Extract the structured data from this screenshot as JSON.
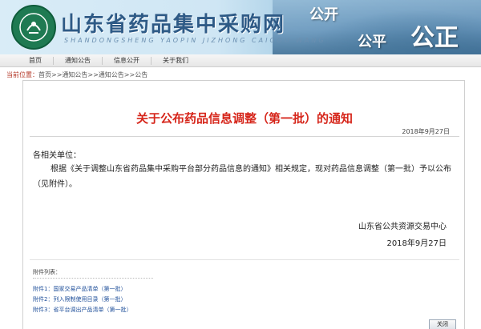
{
  "header": {
    "site_title": "山东省药品集中采购网",
    "site_subtitle": "SHANDONGSHENG YAOPIN JIZHONG CAIGOU WANG",
    "slogans": [
      "公开",
      "公平",
      "公正"
    ]
  },
  "nav": {
    "items": [
      {
        "label": "首页"
      },
      {
        "label": "通知公告"
      },
      {
        "label": "信息公开"
      },
      {
        "label": "关于我们"
      }
    ]
  },
  "breadcrumb": {
    "label": "当前位置：",
    "path": "首页>>通知公告>>通知公告>>公告"
  },
  "notice": {
    "title": "关于公布药品信息调整（第一批）的通知",
    "date": "2018年9月27日",
    "salutation": "各相关单位：",
    "body": "根据《关于调整山东省药品集中采购平台部分药品信息的通知》相关规定，现对药品信息调整（第一批）予以公布（见附件）。",
    "issuer": "山东省公共资源交易中心",
    "issue_date": "2018年9月27日"
  },
  "attachments": {
    "heading": "附件列表：",
    "items": [
      {
        "prefix": "附件1：",
        "name": "国家交易产品清单（第一批）"
      },
      {
        "prefix": "附件2：",
        "name": "列入限制使用目录（第一批）"
      },
      {
        "prefix": "附件3：",
        "name": "省平台调出产品清单（第一批）"
      }
    ]
  },
  "buttons": {
    "close_label": "关闭"
  },
  "colors": {
    "title_red": "#d6261b",
    "link_blue": "#1f4f9a",
    "brand_blue": "#2e5a86"
  }
}
